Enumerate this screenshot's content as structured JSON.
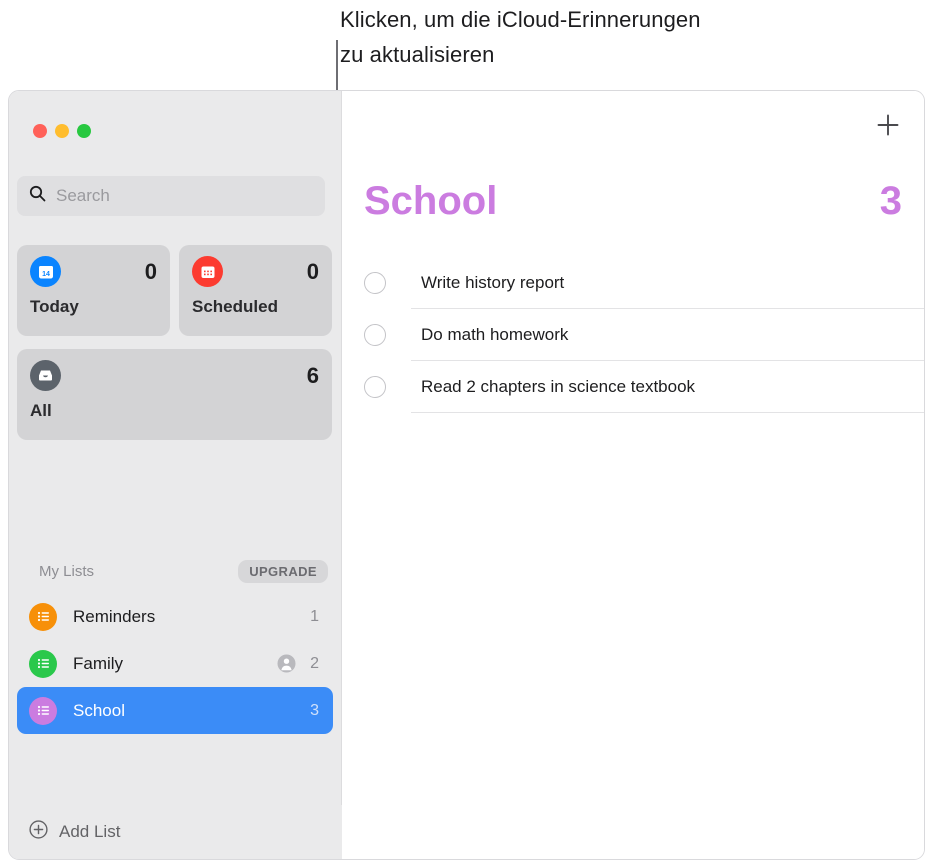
{
  "callout": {
    "text": "Klicken, um die iCloud-Erinnerungen\nzu aktualisieren"
  },
  "window": {
    "traffic_lights": [
      {
        "name": "close",
        "color": "#ff6159"
      },
      {
        "name": "minimize",
        "color": "#ffbd2e"
      },
      {
        "name": "zoom",
        "color": "#28c840"
      }
    ]
  },
  "sidebar": {
    "search": {
      "placeholder": "Search",
      "icon": "search-icon"
    },
    "smart_lists": [
      {
        "label": "Today",
        "count": "0",
        "icon": "calendar-day-icon",
        "color": "#0a84ff"
      },
      {
        "label": "Scheduled",
        "count": "0",
        "icon": "calendar-grid-icon",
        "color": "#fc3b30"
      },
      {
        "label": "All",
        "count": "6",
        "icon": "inbox-icon",
        "color": "#5c636b"
      }
    ],
    "my_lists_header": {
      "label": "My Lists",
      "badge": "UPGRADE"
    },
    "lists": [
      {
        "label": "Reminders",
        "count": "1",
        "color": "#f79009",
        "shared": false,
        "selected": false
      },
      {
        "label": "Family",
        "count": "2",
        "color": "#2ac84b",
        "shared": true,
        "selected": false
      },
      {
        "label": "School",
        "count": "3",
        "color": "#cb7ce0",
        "shared": false,
        "selected": true
      }
    ],
    "add_list": {
      "label": "Add List",
      "icon": "plus-circle-icon"
    }
  },
  "main": {
    "add_button": {
      "icon": "plus-icon"
    },
    "title": "School",
    "count": "3",
    "accent_color": "#cb7ce0",
    "reminders": [
      {
        "text": "Write history report",
        "completed": false
      },
      {
        "text": "Do math homework",
        "completed": false
      },
      {
        "text": "Read 2 chapters in science textbook",
        "completed": false
      }
    ]
  }
}
